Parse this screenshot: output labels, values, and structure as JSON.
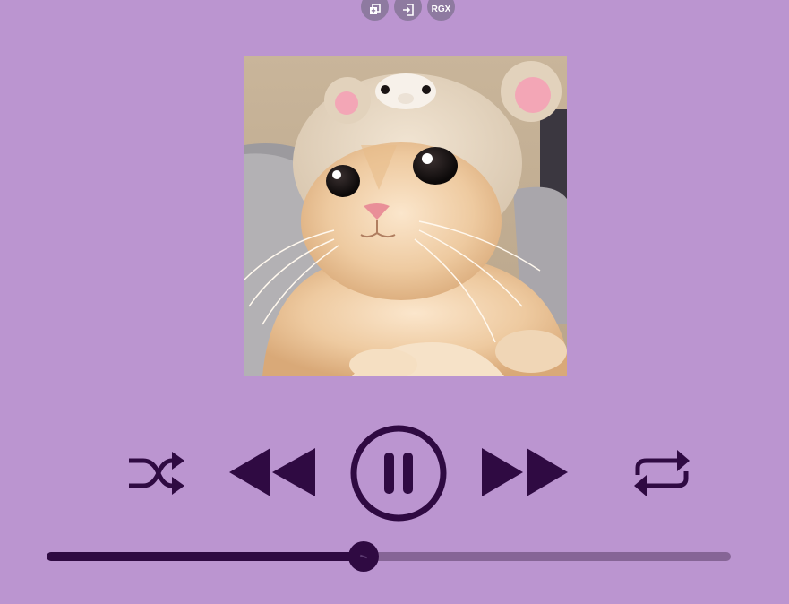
{
  "toolbar": {
    "copy_icon": "copy-window-icon",
    "enter_icon": "enter-icon",
    "rgx_label": "RGX"
  },
  "player": {
    "cover_art": "kitten-in-bear-hat",
    "controls": {
      "shuffle": "shuffle-icon",
      "previous": "rewind-icon",
      "play_state": "pause-icon",
      "next": "fast-forward-icon",
      "repeat": "repeat-icon"
    },
    "progress_fraction": 0.464
  },
  "colors": {
    "background": "#bb95d0",
    "control": "#2f0a42",
    "track": "#866596",
    "tool_button": "#8e7aa0"
  }
}
